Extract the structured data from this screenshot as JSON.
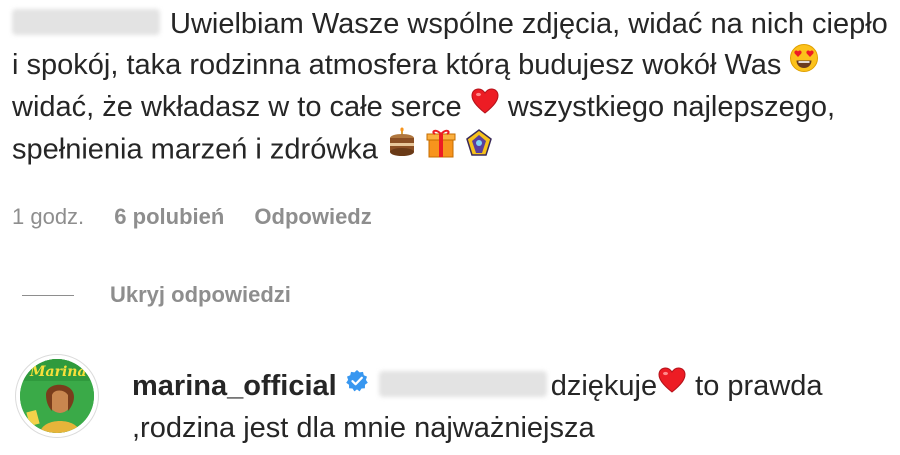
{
  "comment": {
    "author_blurred": "joanna_x_j",
    "text_1": "Uwielbiam Wasze wspólne zdjęcia, widać na nich ciepło i spokój, taka rodzinna atmosfera którą budujesz wokół Was",
    "text_2": "widać, że wkładasz w to całe serce",
    "text_3": "wszystkiego najlepszego, spełnienia marzeń i zdrówka"
  },
  "meta": {
    "time": "1 godz.",
    "likes": "6 polubień",
    "reply": "Odpowiedz"
  },
  "replies_toggle": {
    "label": "Ukryj odpowiedzi"
  },
  "reply": {
    "username": "marina_official",
    "mention_blurred": "@joanna_x_j",
    "text_1": "dziękuje",
    "text_2": "to prawda ,rodzina jest dla mnie najważniejsza"
  },
  "icons": {
    "heart_eyes": "heart-eyes-emoji",
    "heart": "red-heart-emoji",
    "cake": "birthday-cake-emoji",
    "gift": "gift-emoji",
    "crown": "crown-emoji",
    "verified": "verified-badge-icon"
  },
  "colors": {
    "text": "#262626",
    "secondary": "#8e8e8e",
    "verified": "#3897f0",
    "heart": "#ed1c24"
  }
}
